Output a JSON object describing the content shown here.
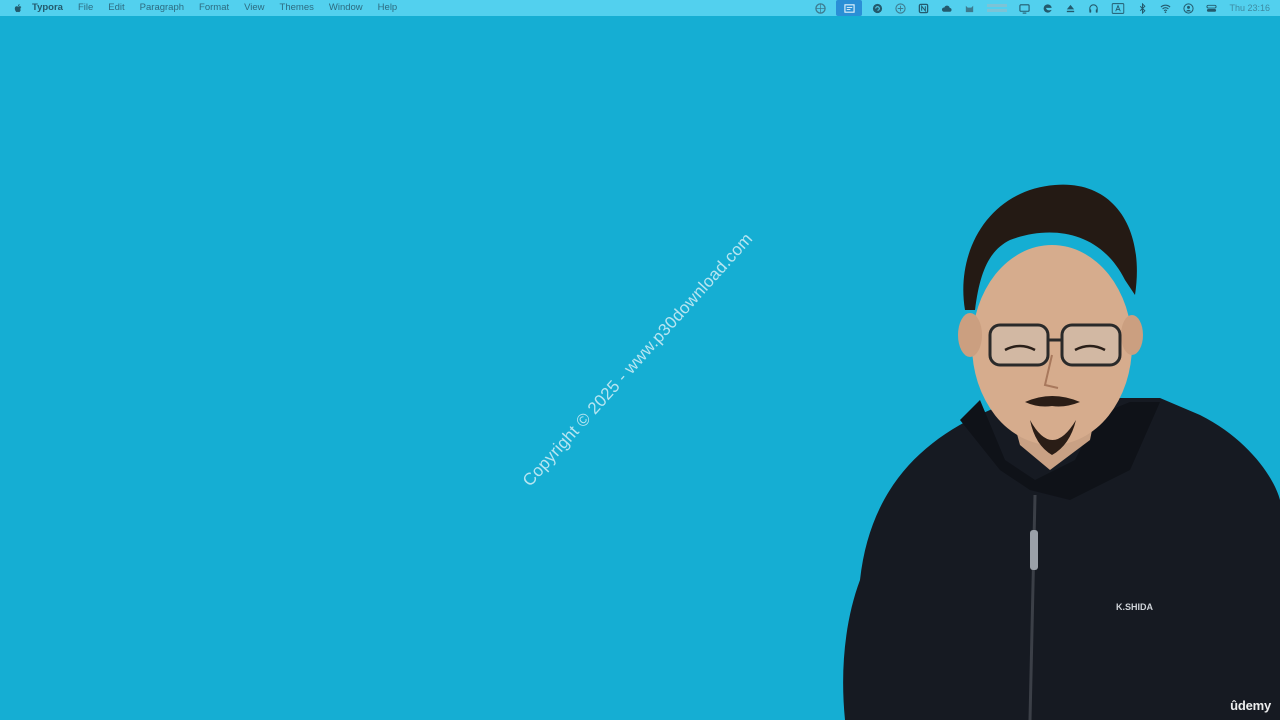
{
  "menubar": {
    "apple_icon": "apple-logo-icon",
    "app_name": "Typora",
    "items": [
      "File",
      "Edit",
      "Paragraph",
      "Format",
      "View",
      "Themes",
      "Window",
      "Help"
    ],
    "clock": "Thu 23:16",
    "status_icons": [
      "color-wheel-icon",
      "screen-capture-icon",
      "sync-icon",
      "layers-icon",
      "notion-icon",
      "cloud-icon",
      "cat-icon",
      "network-stats-icon",
      "display-icon",
      "edge-icon",
      "eject-icon",
      "headphones-icon",
      "input-source-icon",
      "bluetooth-icon",
      "wifi-icon",
      "user-icon",
      "control-center-icon"
    ]
  },
  "desktop": {
    "background_color": "#15aed3",
    "watermark": "Copyright © 2025 - www.p30download.com"
  },
  "presenter": {
    "jacket_logo": "K.SHIDA"
  },
  "branding": {
    "udemy_logo": "ûdemy"
  }
}
